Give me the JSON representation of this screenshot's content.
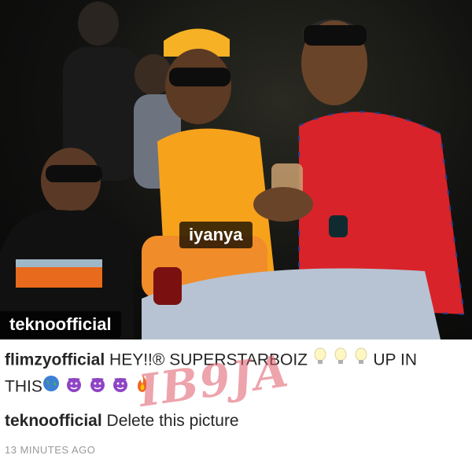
{
  "photo": {
    "tags": [
      {
        "username": "iyanya"
      },
      {
        "username": "teknoofficial"
      }
    ]
  },
  "comments": [
    {
      "username": "flimzyofficial",
      "text_before": "HEY!!® SUPERSTARBOIZ",
      "bulbs": [
        "light-bulb-icon",
        "light-bulb-icon",
        "light-bulb-icon"
      ],
      "text_after": "UP IN",
      "line2_start": "THIS",
      "trailing_emojis": [
        "globe-icon",
        "devil-icon",
        "devil-icon",
        "devil-icon",
        "fire-icon"
      ]
    },
    {
      "username": "teknoofficial",
      "text": "Delete this picture"
    }
  ],
  "timestamp": "13 MINUTES AGO",
  "watermark": "IB9JA",
  "colors": {
    "shirt_orange": "#f7a21b",
    "shirt_red": "#d8232a",
    "watermark": "#e05a6a"
  }
}
